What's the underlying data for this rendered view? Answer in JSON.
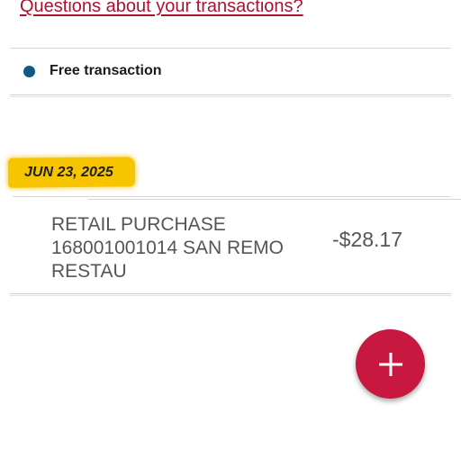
{
  "header": {
    "help_link": "Questions about your transactions?"
  },
  "legend": {
    "label": "Free transaction",
    "dot_color": "#0e5a86"
  },
  "transactions": {
    "date_header": "JUN 23, 2025",
    "date_highlight_color": "#f6c500",
    "items": [
      {
        "description": "RETAIL PURCHASE 168001001014 SAN REMO RESTAU",
        "amount": "-$28.17"
      }
    ]
  },
  "fab": {
    "icon": "plus-icon",
    "color": "#c8183f"
  }
}
